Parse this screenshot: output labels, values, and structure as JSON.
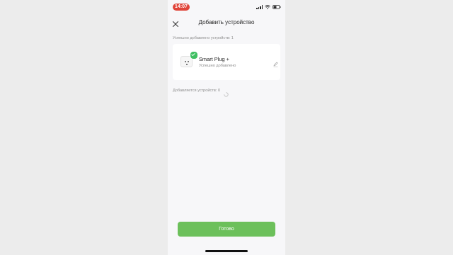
{
  "status_bar": {
    "time": "14:07"
  },
  "header": {
    "title": "Добавить устройство"
  },
  "success_section": {
    "label": "Успешно добавлено устройств: 1"
  },
  "device": {
    "name": "Smart Plug +",
    "status": "Успешно добавлено"
  },
  "pending_section": {
    "label": "Добавляется устройств: 0"
  },
  "footer": {
    "done_label": "Готово"
  },
  "colors": {
    "accent": "#6cc05b",
    "success_badge": "#3fbf62",
    "time_pill": "#e0453a"
  },
  "icons": [
    "close-icon",
    "check-icon",
    "edit-icon",
    "spinner-icon",
    "wifi-icon",
    "battery-icon",
    "signal-icon"
  ]
}
